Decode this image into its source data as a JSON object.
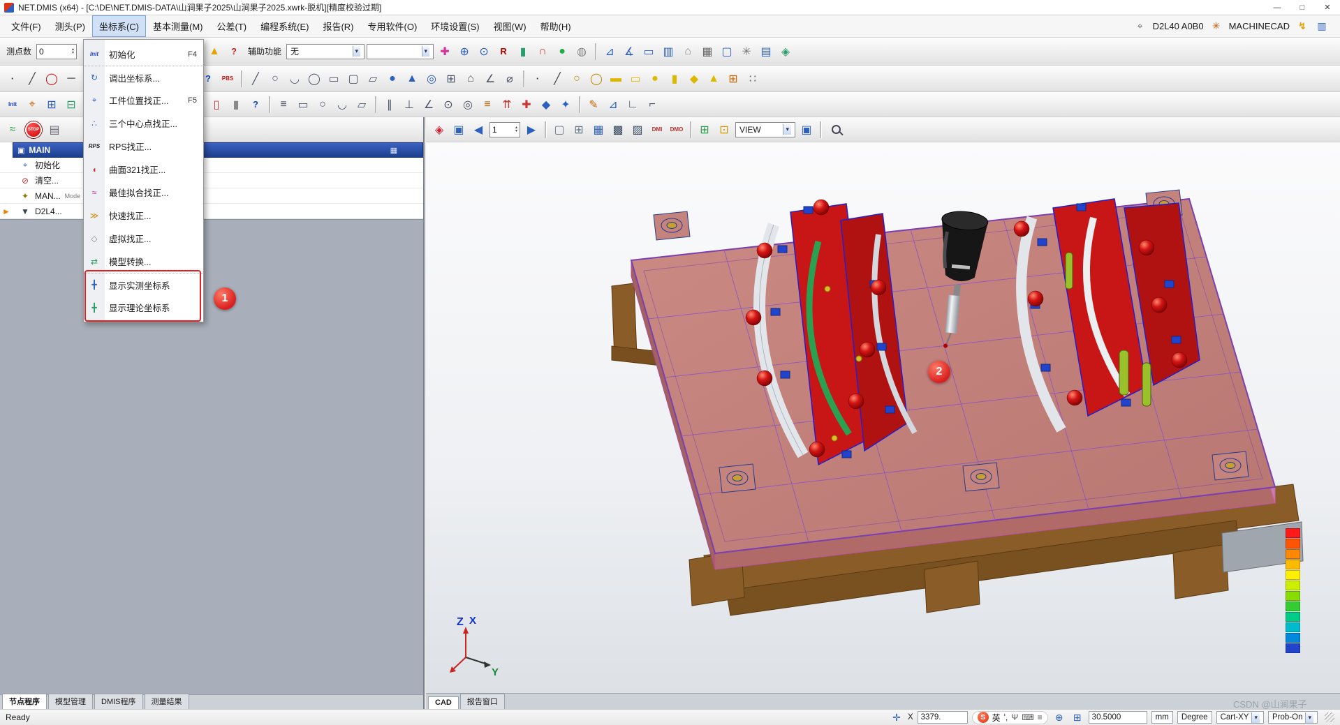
{
  "window": {
    "title": "NET.DMIS (x64) - [C:\\DE\\NET.DMIS-DATA\\山涧果子2025\\山涧果子2025.xwrk-脱机][精度校验过期]"
  },
  "ui": {
    "caret": "▾",
    "spin_up": "▴",
    "spin_down": "▾",
    "min": "—",
    "max": "□",
    "close": "✕",
    "probe_glyph": "⌖",
    "machine_glyph": "✳",
    "lightning_glyph": "↯",
    "display_glyph": "▥",
    "tree_header_icon": "▣",
    "tree_header_right_icon": "▦"
  },
  "menubar": {
    "items": [
      {
        "label": "文件(F)"
      },
      {
        "label": "测头(P)"
      },
      {
        "label": "坐标系(C)",
        "cls": "active"
      },
      {
        "label": "基本测量(M)"
      },
      {
        "label": "公差(T)"
      },
      {
        "label": "编程系统(E)"
      },
      {
        "label": "报告(R)"
      },
      {
        "label": "专用软件(O)"
      },
      {
        "label": "环境设置(S)"
      },
      {
        "label": "视图(W)"
      },
      {
        "label": "帮助(H)"
      }
    ],
    "probe_label": "D2L40  A0B0",
    "machine_label": "MACHINECAD"
  },
  "toolbar1": {
    "point_count_label": "测点数",
    "point_count_value": "0",
    "aux_label": "辅助功能",
    "aux_value": "无",
    "aux_value2": "",
    "icons_a": [
      {
        "g": "✎",
        "c": "#2b5fc0"
      }
    ],
    "icons_b": [
      {
        "cls": "sep"
      },
      {
        "g": "▤",
        "c": "#2a9d6a"
      },
      {
        "g": "⌂",
        "c": "#8a8a8a"
      },
      {
        "g": "▦",
        "c": "#2b5fc0"
      },
      {
        "g": "▥",
        "c": "#2b5fc0"
      },
      {
        "g": "⚑",
        "c": "#cc3333"
      },
      {
        "g": "▲",
        "c": "#e0a800"
      },
      {
        "g": "?",
        "c": "#cc2222",
        "cls": "txtb"
      }
    ],
    "icons_c": [
      {
        "g": "✚",
        "c": "#d6309a"
      },
      {
        "g": "⊕",
        "c": "#2b5fc0"
      },
      {
        "g": "⊙",
        "c": "#2b5fc0"
      },
      {
        "g": "R",
        "c": "#bb0000",
        "cls": "txtb"
      },
      {
        "g": "▮",
        "c": "#2a9d6a"
      },
      {
        "g": "∩",
        "c": "#cc3333"
      },
      {
        "g": "●",
        "c": "#22aa44"
      },
      {
        "g": "◍",
        "c": "#888888"
      },
      {
        "cls": "sep"
      },
      {
        "g": "⊿",
        "c": "#2b5fc0"
      },
      {
        "g": "∡",
        "c": "#2b5fc0"
      },
      {
        "g": "▭",
        "c": "#2b5fc0"
      },
      {
        "g": "▥",
        "c": "#2b5fc0"
      },
      {
        "g": "⌂",
        "c": "#8a8a8a"
      },
      {
        "g": "▦",
        "c": "#666666"
      },
      {
        "g": "▢",
        "c": "#2b5fc0"
      },
      {
        "g": "✳",
        "c": "#777777"
      },
      {
        "g": "▤",
        "c": "#2b5fc0"
      },
      {
        "g": "◈",
        "c": "#2a9d6a"
      }
    ]
  },
  "toolbar2": {
    "icons": [
      {
        "g": "·",
        "c": "#333333",
        "cls": "txtb"
      },
      {
        "g": "╱",
        "c": "#444444"
      },
      {
        "g": "◯",
        "c": "#cc1111"
      },
      {
        "g": "─",
        "c": "#444444"
      },
      {
        "g": "▲",
        "c": "#cc1111"
      },
      {
        "g": "◤",
        "c": "#cc1111"
      },
      {
        "g": "◖",
        "c": "#cc1111"
      },
      {
        "g": "◗",
        "c": "#cc1111"
      },
      {
        "g": "▼",
        "c": "#cc1111"
      },
      {
        "g": "●",
        "c": "#cc1111"
      },
      {
        "g": "?",
        "c": "#1144cc",
        "cls": "txtb"
      },
      {
        "g": "PBS",
        "c": "#cc1111",
        "cls": "txt"
      },
      {
        "cls": "sep"
      },
      {
        "g": "╱",
        "c": "#4a5568"
      },
      {
        "g": "○",
        "c": "#4a5568"
      },
      {
        "g": "◡",
        "c": "#4a5568"
      },
      {
        "g": "◯",
        "c": "#4a5568"
      },
      {
        "g": "▭",
        "c": "#4a5568"
      },
      {
        "g": "▢",
        "c": "#4a5568"
      },
      {
        "g": "▱",
        "c": "#4a5568"
      },
      {
        "g": "●",
        "c": "#2b5fc0"
      },
      {
        "g": "▲",
        "c": "#2b5fc0"
      },
      {
        "g": "◎",
        "c": "#2b5fc0"
      },
      {
        "g": "⊞",
        "c": "#4a5568"
      },
      {
        "g": "⌂",
        "c": "#4a5568"
      },
      {
        "g": "∠",
        "c": "#4a5568"
      },
      {
        "g": "⌀",
        "c": "#4a5568"
      },
      {
        "cls": "sep"
      },
      {
        "g": "·",
        "c": "#333333",
        "cls": "txtb"
      },
      {
        "g": "╱",
        "c": "#444444"
      },
      {
        "g": "○",
        "c": "#bb8800"
      },
      {
        "g": "◯",
        "c": "#bb8800"
      },
      {
        "g": "▬",
        "c": "#ddb800"
      },
      {
        "g": "▭",
        "c": "#ddb800"
      },
      {
        "g": "●",
        "c": "#ddb800"
      },
      {
        "g": "▮",
        "c": "#ddb800"
      },
      {
        "g": "◆",
        "c": "#ddb800"
      },
      {
        "g": "▲",
        "c": "#ddb800"
      },
      {
        "g": "⊞",
        "c": "#cc6600"
      },
      {
        "g": "∷",
        "c": "#666666"
      }
    ]
  },
  "toolbar3": {
    "icons": [
      {
        "g": "Init",
        "c": "#1a3fd0",
        "cls": "txt"
      },
      {
        "g": "⌖",
        "c": "#cc6600"
      },
      {
        "g": "⊞",
        "c": "#2b5fc0"
      },
      {
        "g": "⊟",
        "c": "#2a9d6a"
      },
      {
        "g": "⌂",
        "c": "#cc3333"
      },
      {
        "g": "↻",
        "c": "#2b5fc0"
      },
      {
        "g": "≋",
        "c": "#999999"
      },
      {
        "cls": "sep"
      },
      {
        "g": "▮",
        "c": "#2b5fc0"
      },
      {
        "g": "▮",
        "c": "#cc3333"
      },
      {
        "g": "▮",
        "c": "#2a9d6a"
      },
      {
        "g": "▯",
        "c": "#cc3333"
      },
      {
        "g": "▮",
        "c": "#888888"
      },
      {
        "g": "?",
        "c": "#1144cc",
        "cls": "txtb"
      },
      {
        "cls": "sep"
      },
      {
        "g": "≡",
        "c": "#4a5568"
      },
      {
        "g": "▭",
        "c": "#4a5568"
      },
      {
        "g": "○",
        "c": "#4a5568"
      },
      {
        "g": "◡",
        "c": "#4a5568"
      },
      {
        "g": "▱",
        "c": "#4a5568"
      },
      {
        "cls": "sep"
      },
      {
        "g": "∥",
        "c": "#4a5568"
      },
      {
        "g": "⊥",
        "c": "#4a5568"
      },
      {
        "g": "∠",
        "c": "#4a5568"
      },
      {
        "g": "⊙",
        "c": "#4a5568"
      },
      {
        "g": "◎",
        "c": "#4a5568"
      },
      {
        "g": "≡",
        "c": "#cc6600"
      },
      {
        "g": "⇈",
        "c": "#cc3333"
      },
      {
        "g": "✚",
        "c": "#cc3333"
      },
      {
        "g": "◆",
        "c": "#2b5fc0"
      },
      {
        "g": "✦",
        "c": "#2b5fc0"
      },
      {
        "cls": "sep"
      },
      {
        "g": "✎",
        "c": "#cc6600"
      },
      {
        "g": "⊿",
        "c": "#2b5fc0"
      },
      {
        "g": "∟",
        "c": "#4a5568"
      },
      {
        "g": "⌐",
        "c": "#4a5568"
      }
    ]
  },
  "mini_toolbar": {
    "run_glyph": "≈",
    "stop_label": "STOP",
    "doc_glyph": "▤"
  },
  "coord_menu": {
    "items": [
      {
        "label": "初始化",
        "shortcut": "F4",
        "glyph": "Init",
        "color": "#1a3fd0",
        "iccls": "cm-txt"
      },
      {
        "label": "调出坐标系...",
        "shortcut": "",
        "glyph": "↻",
        "color": "#2b5fc0",
        "cls": "sect"
      },
      {
        "label": "工件位置找正...",
        "shortcut": "F5",
        "glyph": "⌖",
        "color": "#2b5fc0"
      },
      {
        "label": "三个中心点找正...",
        "shortcut": "",
        "glyph": "∴",
        "color": "#2b5fc0"
      },
      {
        "label": "RPS找正...",
        "shortcut": "",
        "glyph": "RPS",
        "color": "#222222",
        "iccls": "cm-txt"
      },
      {
        "label": "曲面321找正...",
        "shortcut": "",
        "glyph": "◖",
        "color": "#cc3333"
      },
      {
        "label": "最佳拟合找正...",
        "shortcut": "",
        "glyph": "≈",
        "color": "#cc3399"
      },
      {
        "label": "快速找正...",
        "shortcut": "",
        "glyph": "≫",
        "color": "#cc8800"
      },
      {
        "label": "虚拟找正...",
        "shortcut": "",
        "glyph": "◇",
        "color": "#888888"
      },
      {
        "label": "模型转换...",
        "shortcut": "",
        "glyph": "⇄",
        "color": "#2a9d6a"
      },
      {
        "label": "显示实测坐标系",
        "shortcut": "",
        "glyph": "╋",
        "color": "#2b5fc0",
        "cls": "sect"
      },
      {
        "label": "显示理论坐标系",
        "shortcut": "",
        "glyph": "╋",
        "color": "#2a9d6a"
      }
    ]
  },
  "tree": {
    "header": {
      "label": "MAIN"
    },
    "rows": [
      {
        "glyph": "⌖",
        "color": "#2b5fc0",
        "label": "初始化",
        "sub": ""
      },
      {
        "glyph": "⊘",
        "color": "#cc3333",
        "label": "清空...",
        "sub": ""
      },
      {
        "glyph": "✦",
        "color": "#997700",
        "label": "MAN...",
        "sub": "Mode"
      },
      {
        "glyph": "▼",
        "color": "#334455",
        "label": "D2L4...",
        "sub": "",
        "cls": "current"
      }
    ]
  },
  "left_tabs": {
    "items": [
      {
        "label": "节点程序",
        "cls": "active"
      },
      {
        "label": "模型管理"
      },
      {
        "label": "DMIS程序"
      },
      {
        "label": "测量结果"
      }
    ]
  },
  "vp_toolbar": {
    "icons_a": [
      {
        "g": "◈",
        "c": "#cc2233"
      },
      {
        "g": "▣",
        "c": "#2b5fc0"
      },
      {
        "g": "◀",
        "c": "#2b5fc0"
      }
    ],
    "nav_value": "1",
    "icons_b": [
      {
        "g": "▶",
        "c": "#2b5fc0"
      },
      {
        "cls": "sep"
      },
      {
        "g": "▢",
        "c": "#667788"
      },
      {
        "g": "⊞",
        "c": "#667788"
      },
      {
        "g": "▦",
        "c": "#2b5fc0"
      },
      {
        "g": "▩",
        "c": "#33475f"
      },
      {
        "g": "▨",
        "c": "#33475f"
      },
      {
        "g": "DMI",
        "c": "#b03030",
        "cls": "txt"
      },
      {
        "g": "DMO",
        "c": "#b03030",
        "cls": "txt"
      },
      {
        "cls": "sep"
      },
      {
        "g": "⊞",
        "c": "#2a9d4a"
      },
      {
        "g": "⊡",
        "c": "#cc9900"
      }
    ],
    "view_label": "VIEW",
    "icons_c": [
      {
        "g": "▣",
        "c": "#2b5fc0"
      },
      {
        "cls": "sep"
      }
    ]
  },
  "vp_tabs": {
    "items": [
      {
        "label": "CAD",
        "cls": "active"
      },
      {
        "label": "报告窗口"
      }
    ]
  },
  "legend": {
    "colors": [
      "#ff1a1a",
      "#ff5500",
      "#ff8800",
      "#ffbb00",
      "#ffee00",
      "#ccee00",
      "#88dd00",
      "#33cc33",
      "#00cc88",
      "#00bbcc",
      "#0088dd",
      "#2244cc"
    ]
  },
  "axis": {
    "z": "Z",
    "x": "X",
    "y": "Y"
  },
  "annotations": {
    "step1": "1",
    "step2": "2"
  },
  "statusbar": {
    "ready": "Ready",
    "move_glyph": "✛",
    "x_label": "X",
    "x_value": "3379.",
    "ime": {
      "logo": "S",
      "lang": "英",
      "punct": "',",
      "mic_glyph": "Ψ",
      "kb_glyph": "⌨",
      "menu_glyph": "≡"
    },
    "probe_tree_glyph": "⊕",
    "grid_glyph": "⊞",
    "step_value": "30.5000",
    "unit": "mm",
    "angle_unit": "Degree",
    "coord_mode": "Cart-XY",
    "probe_mode": "Prob-On"
  },
  "watermark": "CSDN @山涧果子",
  "colors": {
    "annotation_red": "#e02020",
    "selection_blue": "#1e3f8f",
    "plate_salmon": "#c4837d",
    "fixture_red": "#c81616",
    "base_brown": "#8a5c28"
  }
}
